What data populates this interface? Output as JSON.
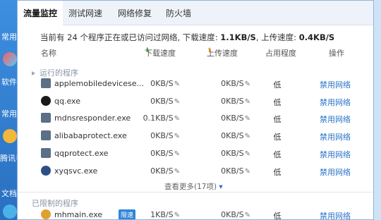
{
  "background": {
    "labels": [
      "常用",
      "软件",
      "常用",
      "腾讯手",
      "文档"
    ]
  },
  "tabs": [
    {
      "label": "流量监控"
    },
    {
      "label": "测试网速"
    },
    {
      "label": "网络修复"
    },
    {
      "label": "防火墙"
    }
  ],
  "summary": {
    "prefix": "当前有 24 个程序正在或已访问过网络, 下载速度: ",
    "down": "1.1KB/S",
    "mid": ", 上传速度: ",
    "up": "0.4KB/S"
  },
  "columns": {
    "name": "名称",
    "down": "下载速度",
    "up": "上传速度",
    "level": "占用程度",
    "action": "操作"
  },
  "running": {
    "title": "运行的程序",
    "rows": [
      {
        "name": "applemobiledevicese...",
        "down": "0KB/S",
        "up": "0KB/S",
        "level": "低",
        "action": "禁用网络",
        "icon_color": "#5b6f86"
      },
      {
        "name": "qq.exe",
        "down": "0KB/S",
        "up": "0KB/S",
        "level": "低",
        "action": "禁用网络",
        "icon_color": "#1a1a1a"
      },
      {
        "name": "mdnsresponder.exe",
        "down": "0.1KB/S",
        "up": "0KB/S",
        "level": "低",
        "action": "禁用网络",
        "icon_color": "#5b6f86"
      },
      {
        "name": "alibabaprotect.exe",
        "down": "0KB/S",
        "up": "0KB/S",
        "level": "低",
        "action": "禁用网络",
        "icon_color": "#5b6f86"
      },
      {
        "name": "qqprotect.exe",
        "down": "0KB/S",
        "up": "0KB/S",
        "level": "低",
        "action": "禁用网络",
        "icon_color": "#5b6f86"
      },
      {
        "name": "xyqsvc.exe",
        "down": "0KB/S",
        "up": "0KB/S",
        "level": "低",
        "action": "禁用网络",
        "icon_color": "#2c4f86"
      }
    ]
  },
  "more": "查看更多(17项)",
  "limited": {
    "title": "已限制的程序",
    "rows": [
      {
        "name": "mhmain.exe",
        "badge": "限速",
        "down": "1KB/S",
        "up": "0KB/S",
        "level": "低",
        "action": "禁用网络"
      }
    ]
  }
}
